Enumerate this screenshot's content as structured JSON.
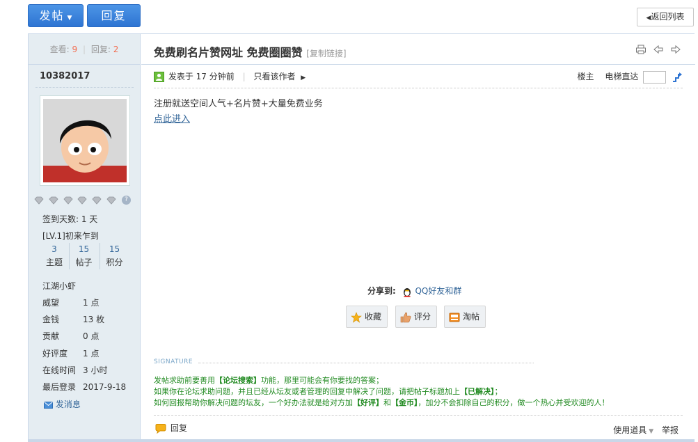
{
  "toolbar": {
    "post_label": "发帖",
    "reply_label": "回复",
    "back_label": "返回列表"
  },
  "sidebar": {
    "views_label": "查看:",
    "views": "9",
    "replies_label": "回复:",
    "replies": "2",
    "username": "10382017",
    "signin_days": "签到天数: 1 天",
    "level": "[LV.1]初来乍到",
    "user_stats": [
      {
        "value": "3",
        "label": "主题"
      },
      {
        "value": "15",
        "label": "帖子"
      },
      {
        "value": "15",
        "label": "积分"
      }
    ],
    "rank": "江湖小虾",
    "profile": [
      {
        "key": "威望",
        "value": "1 点"
      },
      {
        "key": "金钱",
        "value": "13 枚"
      },
      {
        "key": "贡献",
        "value": "0 点"
      },
      {
        "key": "好评度",
        "value": "1 点"
      },
      {
        "key": "在线时间",
        "value": "3 小时"
      },
      {
        "key": "最后登录",
        "value": "2017-9-18"
      }
    ],
    "pm_label": "发消息"
  },
  "thread": {
    "title": "免费刷名片赞网址 免费圈圈赞",
    "copy_link": "[复制链接]",
    "posted": "发表于 17 分钟前",
    "only_author": "只看该作者",
    "floor_label": "楼主",
    "jump_label": "电梯直达"
  },
  "post": {
    "line1": "注册就送空间人气+名片赞+大量免费业务",
    "link": "点此进入"
  },
  "share": {
    "label": "分享到:",
    "qq": "QQ好友和群"
  },
  "actions": {
    "favorite": "收藏",
    "rate": "评分",
    "taobao": "淘帖"
  },
  "signature": {
    "label": "SIGNATURE",
    "line1_a": "发帖求助前要善用",
    "line1_b": "【论坛搜索】",
    "line1_c": "功能，那里可能会有你要找的答案；",
    "line2_a": "如果你在论坛求助问题，并且已经从坛友或者管理的回复中解决了问题，请把帖子标题加上",
    "line2_b": "【已解决】",
    "line2_c": "；",
    "line3_a": "如何回报帮助你解决问题的坛友，一个好办法就是给对方加",
    "line3_b": "【好评】",
    "line3_c": "和",
    "line3_d": "【金币】",
    "line3_e": "，加分不会扣除自己的积分，做一个热心并受欢迎的人！"
  },
  "footer": {
    "reply": "回复",
    "use_tools": "使用道具",
    "report": "举报"
  },
  "colors": {
    "accent_blue": "#2e74d2",
    "sidebar_bg": "#e5edf2",
    "link": "#336699",
    "signature_green": "#228b22"
  }
}
